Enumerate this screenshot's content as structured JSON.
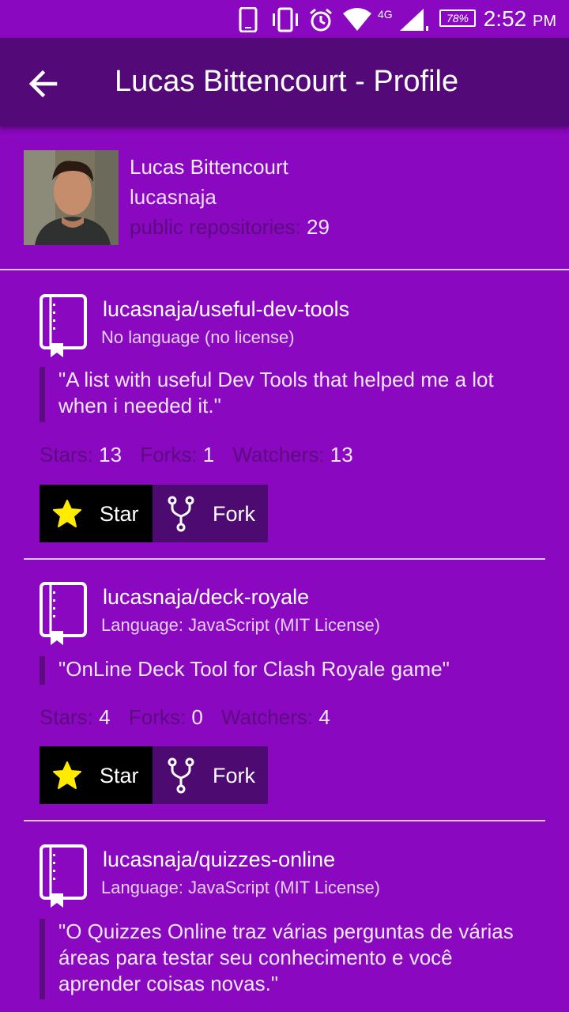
{
  "status_bar": {
    "network": "4G",
    "battery": "78%",
    "time": "2:52",
    "ampm": "PM"
  },
  "app_bar": {
    "title": "Lucas Bittencourt - Profile"
  },
  "profile": {
    "name": "Lucas Bittencourt",
    "login": "lucasnaja",
    "public_repos_label": "public repositories:",
    "public_repos_value": "29"
  },
  "labels": {
    "stars": "Stars:",
    "forks": "Forks:",
    "watchers": "Watchers:",
    "star_button": "Star",
    "fork_button": "Fork"
  },
  "repos": [
    {
      "name": "lucasnaja/useful-dev-tools",
      "language": "No language (no license)",
      "description": "\"A list with useful Dev Tools that helped me a lot when i needed it.\"",
      "stars": "13",
      "forks": "1",
      "watchers": "13"
    },
    {
      "name": "lucasnaja/deck-royale",
      "language": "Language: JavaScript (MIT License)",
      "description": "\"OnLine Deck Tool for Clash Royale game\"",
      "stars": "4",
      "forks": "0",
      "watchers": "4"
    },
    {
      "name": "lucasnaja/quizzes-online",
      "language": "Language: JavaScript (MIT License)",
      "description": "\"O Quizzes Online traz várias perguntas de várias áreas para testar seu conhecimento e você aprender coisas novas.\""
    }
  ],
  "colors": {
    "background": "#8a08bf",
    "app_bar": "#530a78",
    "muted_text": "#5c0b80",
    "star_button": "#000000",
    "fork_button": "#4d0a70",
    "star_icon": "#ffeb00"
  }
}
